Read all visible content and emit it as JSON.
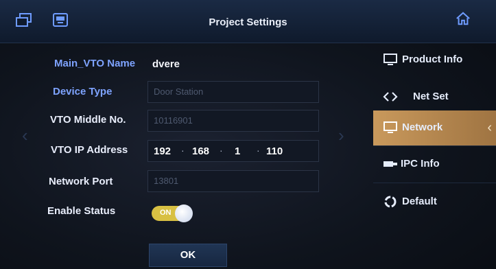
{
  "header": {
    "title": "Project Settings"
  },
  "form": {
    "main_vto_name": {
      "label": "Main_VTO Name",
      "value": "dvere"
    },
    "device_type": {
      "label": "Device Type",
      "value": "Door Station"
    },
    "vto_middle_no": {
      "label": "VTO Middle No.",
      "value": "10116901"
    },
    "vto_ip_address": {
      "label": "VTO IP Address",
      "octets": [
        "192",
        "168",
        "1",
        "110"
      ]
    },
    "network_port": {
      "label": "Network Port",
      "value": "13801"
    },
    "enable_status": {
      "label": "Enable Status",
      "toggle_text": "ON"
    }
  },
  "ok_label": "OK",
  "menu": {
    "items": [
      {
        "label": "Product Info",
        "icon": "monitor-icon"
      },
      {
        "label": "Net Set",
        "icon": "code-arrows-icon"
      },
      {
        "label": "Network",
        "icon": "monitor-icon",
        "active": true
      },
      {
        "label": "IPC Info",
        "icon": "camera-icon"
      },
      {
        "label": "Default",
        "icon": "recycle-icon"
      }
    ]
  },
  "colors": {
    "accent": "#c9995c",
    "label_blue": "#7ea3ff",
    "toggle": "#d8c043"
  }
}
